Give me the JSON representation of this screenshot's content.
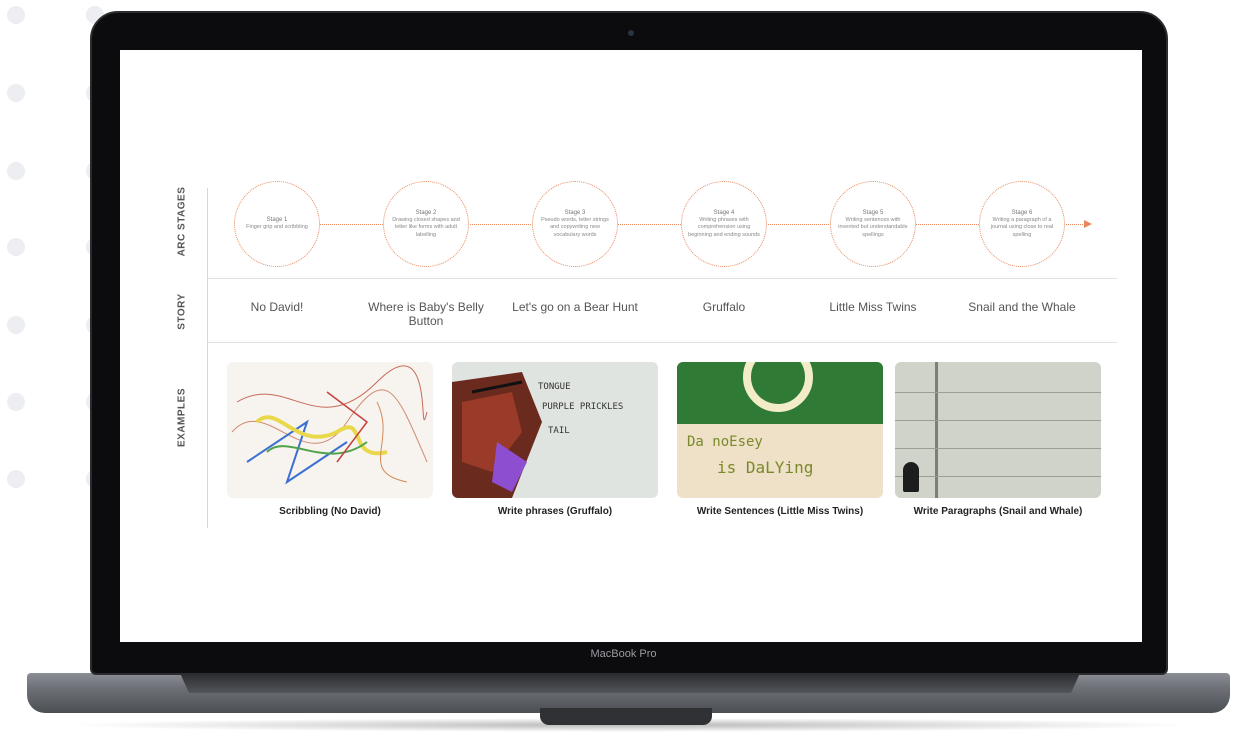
{
  "device": {
    "brand_label": "MacBook Pro"
  },
  "slide": {
    "row_labels": {
      "stages": "ARC STAGES",
      "story": "STORY",
      "examples": "EXAMPLES"
    },
    "stages": [
      {
        "title": "Stage 1",
        "desc": "Finger grip and scribbling"
      },
      {
        "title": "Stage 2",
        "desc": "Drawing closed shapes and letter like forms with adult labelling"
      },
      {
        "title": "Stage 3",
        "desc": "Pseudo words, letter strings and copywriting new vocabulary words"
      },
      {
        "title": "Stage 4",
        "desc": "Writing phrases with comprehension using beginning and ending sounds"
      },
      {
        "title": "Stage 5",
        "desc": "Writing sentences with invented but understandable spellings"
      },
      {
        "title": "Stage 6",
        "desc": "Writing a paragraph of a journal using close to real spelling"
      }
    ],
    "stories": [
      "No David!",
      "Where is Baby's Belly Button",
      "Let's go on a Bear Hunt",
      "Gruffalo",
      "Little Miss Twins",
      "Snail and the Whale"
    ],
    "examples": [
      {
        "caption": "Scribbling (No David)"
      },
      {
        "caption": "Write phrases (Gruffalo)"
      },
      {
        "caption": "Write Sentences (Little Miss Twins)"
      },
      {
        "caption": "Write Paragraphs (Snail and Whale)"
      }
    ],
    "accent_color": "#e8875b"
  }
}
